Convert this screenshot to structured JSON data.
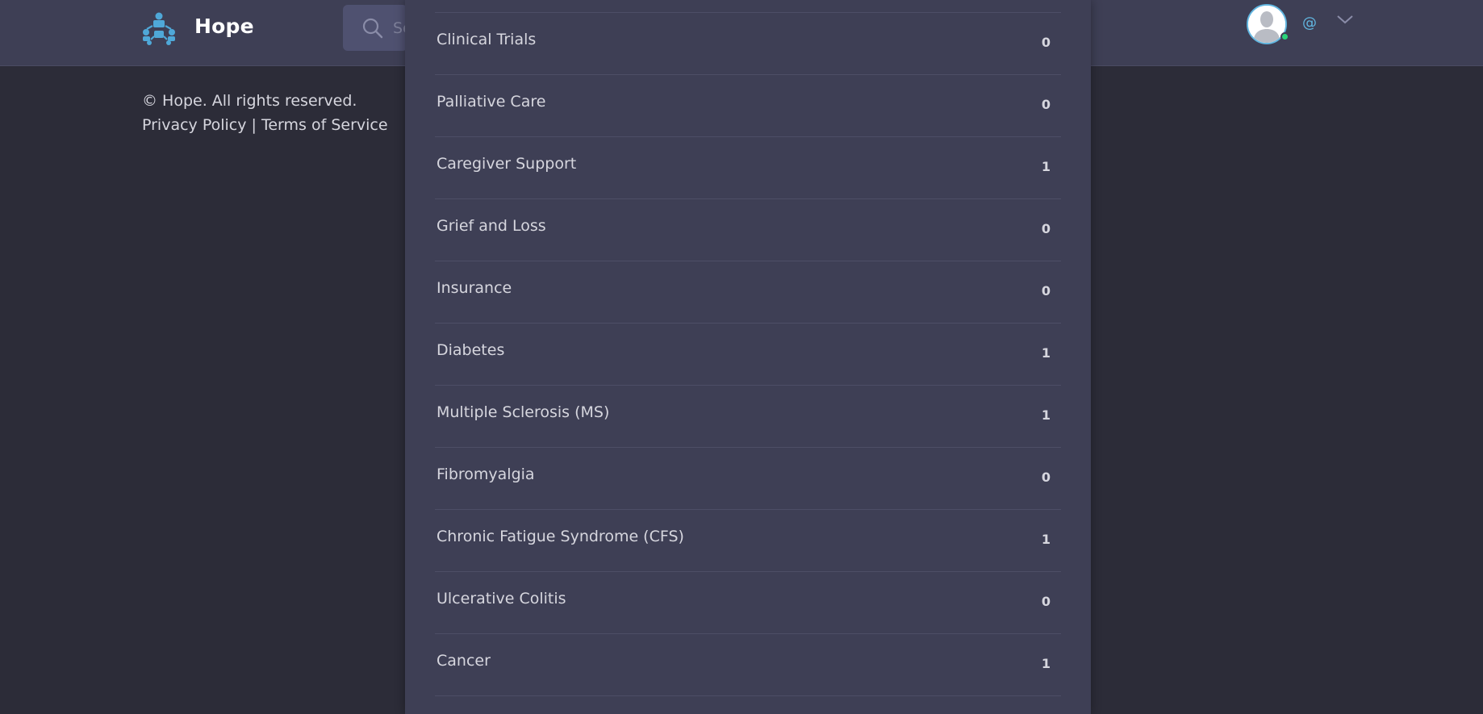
{
  "header": {
    "brand": "Hope",
    "search_placeholder": "Se",
    "user_handle": "@"
  },
  "footer": {
    "copyright": "© Hope. All rights reserved.",
    "privacy_link": "Privacy Policy",
    "separator": " | ",
    "terms_link": "Terms of Service"
  },
  "topics": [
    {
      "label": "Clinical Trials",
      "count": "0"
    },
    {
      "label": "Palliative Care",
      "count": "0"
    },
    {
      "label": "Caregiver Support",
      "count": "1"
    },
    {
      "label": "Grief and Loss",
      "count": "0"
    },
    {
      "label": "Insurance",
      "count": "0"
    },
    {
      "label": "Diabetes",
      "count": "1"
    },
    {
      "label": "Multiple Sclerosis (MS)",
      "count": "1"
    },
    {
      "label": "Fibromyalgia",
      "count": "0"
    },
    {
      "label": "Chronic Fatigue Syndrome (CFS)",
      "count": "1"
    },
    {
      "label": "Ulcerative Colitis",
      "count": "0"
    },
    {
      "label": "Cancer",
      "count": "1"
    }
  ],
  "colors": {
    "accent": "#61b6e0",
    "online": "#2bd47a",
    "background": "#2c2c38",
    "panel": "#3e3f55"
  },
  "icons": {
    "logo": "people-network-icon",
    "search": "search-icon",
    "avatar": "user-silhouette-icon",
    "menu": "chevron-down-icon"
  }
}
